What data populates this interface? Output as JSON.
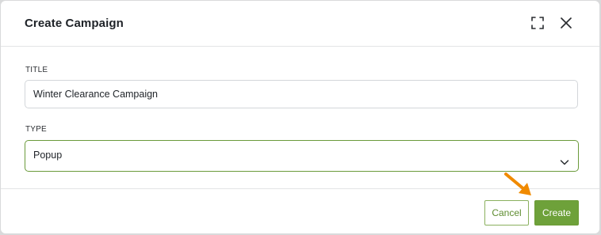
{
  "dialog": {
    "title": "Create Campaign",
    "expand_icon": "expand-icon",
    "close_icon": "close-icon"
  },
  "form": {
    "title_label": "TITLE",
    "title_value": "Winter Clearance Campaign",
    "type_label": "TYPE",
    "type_value": "Popup",
    "type_icon": "chevron-down-icon"
  },
  "footer": {
    "cancel_label": "Cancel",
    "create_label": "Create"
  },
  "colors": {
    "accent": "#6ea13a",
    "annotation_arrow": "#f08a00"
  }
}
